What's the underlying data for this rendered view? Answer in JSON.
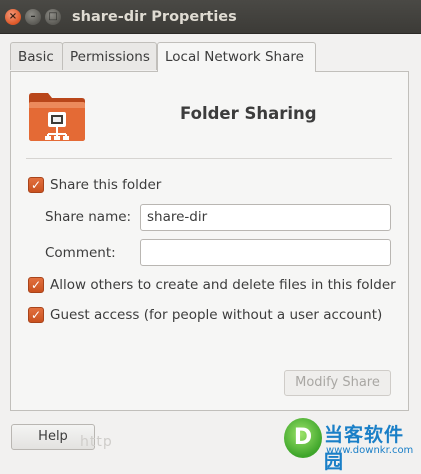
{
  "window": {
    "title": "share-dir Properties",
    "close_glyph": "×",
    "minimize_glyph": "–",
    "maximize_glyph": "□"
  },
  "tabs": [
    {
      "label": "Basic",
      "selected": false
    },
    {
      "label": "Permissions",
      "selected": false
    },
    {
      "label": "Local Network Share",
      "selected": true
    }
  ],
  "share": {
    "icon": "folder-share-icon",
    "heading": "Folder Sharing",
    "share_this_folder": {
      "label": "Share this folder",
      "checked": true
    },
    "share_name": {
      "label": "Share name:",
      "value": "share-dir"
    },
    "comment": {
      "label": "Comment:",
      "value": ""
    },
    "allow_others": {
      "label": "Allow others to create and delete files in this folder",
      "checked": true
    },
    "guest_access": {
      "label": "Guest access (for people without a user account)",
      "checked": true
    },
    "modify_button": {
      "label": "Modify Share",
      "enabled": false
    }
  },
  "footer": {
    "help_label": "Help"
  },
  "watermark": {
    "text": "http",
    "site_name": "当客软件园",
    "site_url": "www.downkr.com"
  },
  "colors": {
    "accent": "#dd5a24",
    "check": "#d2582a",
    "title_bar": "#3c3b37",
    "folder": "#e46a35"
  }
}
